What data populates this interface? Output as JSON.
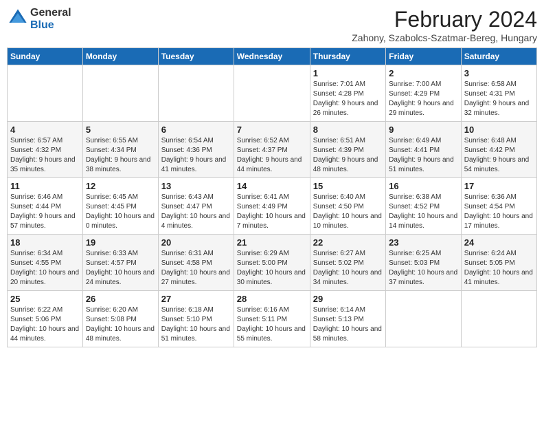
{
  "header": {
    "logo_line1": "General",
    "logo_line2": "Blue",
    "month_title": "February 2024",
    "location": "Zahony, Szabolcs-Szatmar-Bereg, Hungary"
  },
  "days_of_week": [
    "Sunday",
    "Monday",
    "Tuesday",
    "Wednesday",
    "Thursday",
    "Friday",
    "Saturday"
  ],
  "weeks": [
    [
      {
        "day": "",
        "info": ""
      },
      {
        "day": "",
        "info": ""
      },
      {
        "day": "",
        "info": ""
      },
      {
        "day": "",
        "info": ""
      },
      {
        "day": "1",
        "info": "Sunrise: 7:01 AM\nSunset: 4:28 PM\nDaylight: 9 hours and 26 minutes."
      },
      {
        "day": "2",
        "info": "Sunrise: 7:00 AM\nSunset: 4:29 PM\nDaylight: 9 hours and 29 minutes."
      },
      {
        "day": "3",
        "info": "Sunrise: 6:58 AM\nSunset: 4:31 PM\nDaylight: 9 hours and 32 minutes."
      }
    ],
    [
      {
        "day": "4",
        "info": "Sunrise: 6:57 AM\nSunset: 4:32 PM\nDaylight: 9 hours and 35 minutes."
      },
      {
        "day": "5",
        "info": "Sunrise: 6:55 AM\nSunset: 4:34 PM\nDaylight: 9 hours and 38 minutes."
      },
      {
        "day": "6",
        "info": "Sunrise: 6:54 AM\nSunset: 4:36 PM\nDaylight: 9 hours and 41 minutes."
      },
      {
        "day": "7",
        "info": "Sunrise: 6:52 AM\nSunset: 4:37 PM\nDaylight: 9 hours and 44 minutes."
      },
      {
        "day": "8",
        "info": "Sunrise: 6:51 AM\nSunset: 4:39 PM\nDaylight: 9 hours and 48 minutes."
      },
      {
        "day": "9",
        "info": "Sunrise: 6:49 AM\nSunset: 4:41 PM\nDaylight: 9 hours and 51 minutes."
      },
      {
        "day": "10",
        "info": "Sunrise: 6:48 AM\nSunset: 4:42 PM\nDaylight: 9 hours and 54 minutes."
      }
    ],
    [
      {
        "day": "11",
        "info": "Sunrise: 6:46 AM\nSunset: 4:44 PM\nDaylight: 9 hours and 57 minutes."
      },
      {
        "day": "12",
        "info": "Sunrise: 6:45 AM\nSunset: 4:45 PM\nDaylight: 10 hours and 0 minutes."
      },
      {
        "day": "13",
        "info": "Sunrise: 6:43 AM\nSunset: 4:47 PM\nDaylight: 10 hours and 4 minutes."
      },
      {
        "day": "14",
        "info": "Sunrise: 6:41 AM\nSunset: 4:49 PM\nDaylight: 10 hours and 7 minutes."
      },
      {
        "day": "15",
        "info": "Sunrise: 6:40 AM\nSunset: 4:50 PM\nDaylight: 10 hours and 10 minutes."
      },
      {
        "day": "16",
        "info": "Sunrise: 6:38 AM\nSunset: 4:52 PM\nDaylight: 10 hours and 14 minutes."
      },
      {
        "day": "17",
        "info": "Sunrise: 6:36 AM\nSunset: 4:54 PM\nDaylight: 10 hours and 17 minutes."
      }
    ],
    [
      {
        "day": "18",
        "info": "Sunrise: 6:34 AM\nSunset: 4:55 PM\nDaylight: 10 hours and 20 minutes."
      },
      {
        "day": "19",
        "info": "Sunrise: 6:33 AM\nSunset: 4:57 PM\nDaylight: 10 hours and 24 minutes."
      },
      {
        "day": "20",
        "info": "Sunrise: 6:31 AM\nSunset: 4:58 PM\nDaylight: 10 hours and 27 minutes."
      },
      {
        "day": "21",
        "info": "Sunrise: 6:29 AM\nSunset: 5:00 PM\nDaylight: 10 hours and 30 minutes."
      },
      {
        "day": "22",
        "info": "Sunrise: 6:27 AM\nSunset: 5:02 PM\nDaylight: 10 hours and 34 minutes."
      },
      {
        "day": "23",
        "info": "Sunrise: 6:25 AM\nSunset: 5:03 PM\nDaylight: 10 hours and 37 minutes."
      },
      {
        "day": "24",
        "info": "Sunrise: 6:24 AM\nSunset: 5:05 PM\nDaylight: 10 hours and 41 minutes."
      }
    ],
    [
      {
        "day": "25",
        "info": "Sunrise: 6:22 AM\nSunset: 5:06 PM\nDaylight: 10 hours and 44 minutes."
      },
      {
        "day": "26",
        "info": "Sunrise: 6:20 AM\nSunset: 5:08 PM\nDaylight: 10 hours and 48 minutes."
      },
      {
        "day": "27",
        "info": "Sunrise: 6:18 AM\nSunset: 5:10 PM\nDaylight: 10 hours and 51 minutes."
      },
      {
        "day": "28",
        "info": "Sunrise: 6:16 AM\nSunset: 5:11 PM\nDaylight: 10 hours and 55 minutes."
      },
      {
        "day": "29",
        "info": "Sunrise: 6:14 AM\nSunset: 5:13 PM\nDaylight: 10 hours and 58 minutes."
      },
      {
        "day": "",
        "info": ""
      },
      {
        "day": "",
        "info": ""
      }
    ]
  ]
}
